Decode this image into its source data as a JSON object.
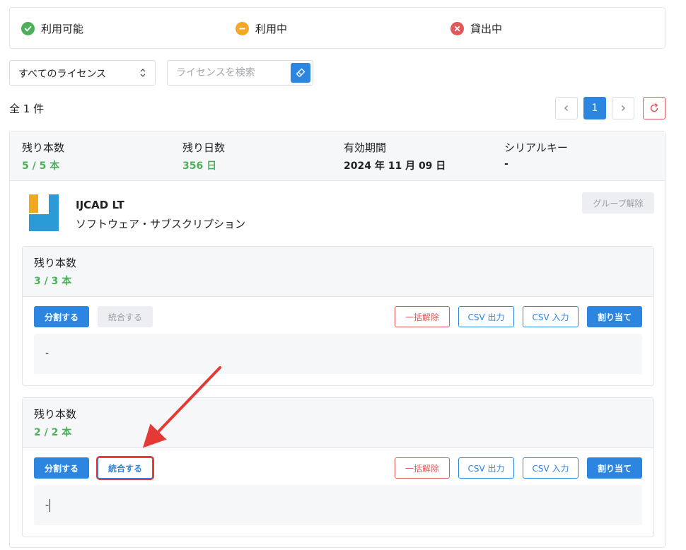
{
  "legend": {
    "available": "利用可能",
    "in_use": "利用中",
    "lent": "貸出中"
  },
  "filter": {
    "select_value": "すべてのライセンス",
    "search_placeholder": "ライセンスを検索"
  },
  "summary": {
    "count_text": "全 1 件"
  },
  "pagination": {
    "prev": "‹",
    "current": "1",
    "next": "›"
  },
  "license": {
    "remaining_count_label": "残り本数",
    "remaining_count_value": "5 / 5 本",
    "remaining_days_label": "残り日数",
    "remaining_days_value": "356 日",
    "validity_label": "有効期間",
    "validity_value": "2024 年 11 月 09 日",
    "serial_label": "シリアルキー",
    "serial_value": "-",
    "product_name": "IJCAD LT",
    "product_type": "ソフトウェア・サブスクリプション",
    "ungroup_label": "グループ解除"
  },
  "groups": [
    {
      "remaining_label": "残り本数",
      "remaining_value": "3 / 3 本",
      "split_label": "分割する",
      "merge_label": "統合する",
      "bulk_release_label": "一括解除",
      "csv_export_label": "CSV 出力",
      "csv_import_label": "CSV 入力",
      "assign_label": "割り当て",
      "serials": "-"
    },
    {
      "remaining_label": "残り本数",
      "remaining_value": "2 / 2 本",
      "split_label": "分割する",
      "merge_label": "統合する",
      "bulk_release_label": "一括解除",
      "csv_export_label": "CSV 出力",
      "csv_import_label": "CSV 入力",
      "assign_label": "割り当て",
      "serials": "-"
    }
  ],
  "colors": {
    "primary": "#2c86e0",
    "success": "#4cb05a",
    "warning": "#f5a623",
    "danger": "#e0585a",
    "annotation": "#e53935"
  }
}
